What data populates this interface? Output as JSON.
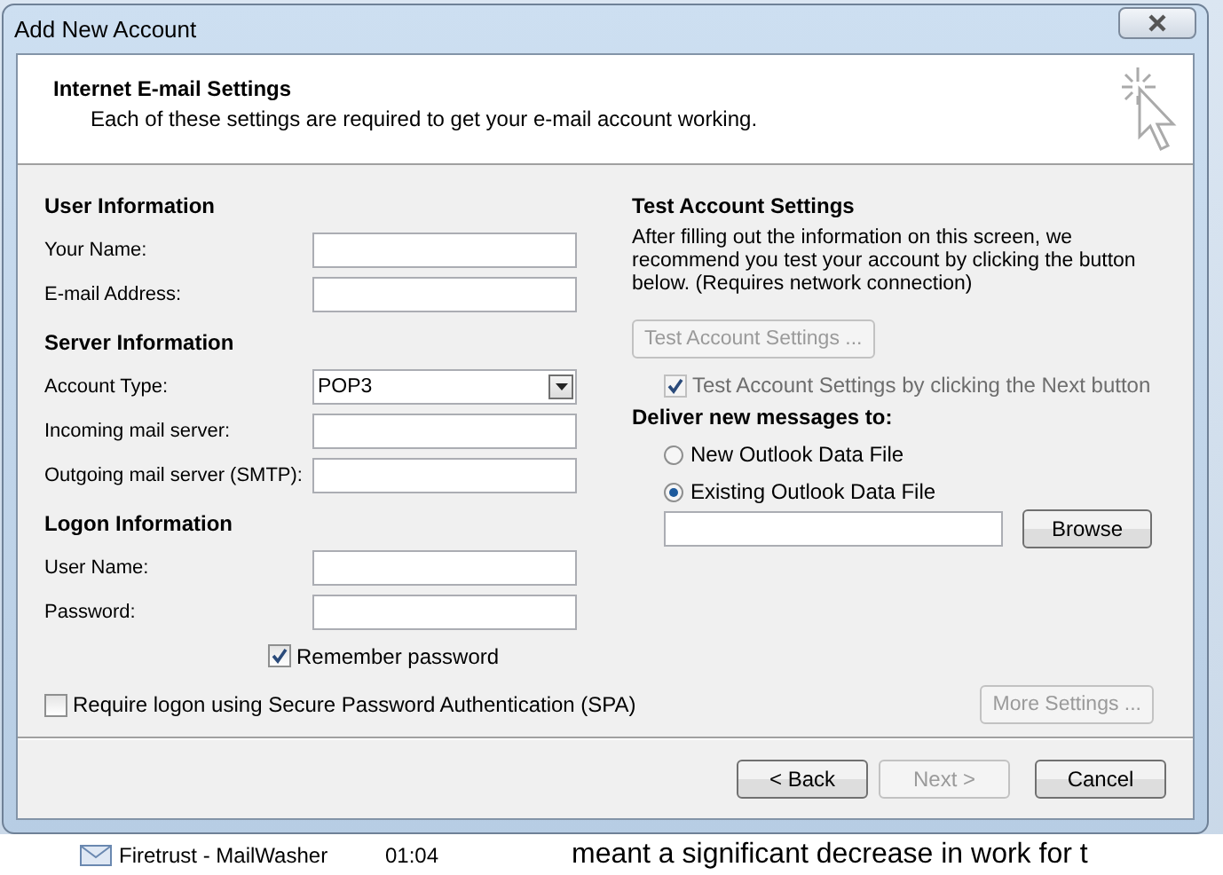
{
  "window": {
    "title": "Add New Account"
  },
  "header": {
    "title": "Internet E-mail Settings",
    "subtitle": "Each of these settings are required to get your e-mail account working."
  },
  "left_sections": [
    {
      "heading": "User Information",
      "fields": [
        {
          "kind": "text",
          "label": "Your Name:"
        },
        {
          "kind": "text",
          "label": "E-mail Address:"
        }
      ]
    },
    {
      "heading": "Server Information",
      "fields": [
        {
          "kind": "dropdown",
          "label": "Account Type:",
          "value": "POP3"
        },
        {
          "kind": "text",
          "label": "Incoming mail server:"
        },
        {
          "kind": "text",
          "label": "Outgoing mail server (SMTP):"
        }
      ]
    },
    {
      "heading": "Logon Information",
      "fields": [
        {
          "kind": "text",
          "label": "User Name:"
        },
        {
          "kind": "text",
          "label": "Password:"
        },
        {
          "kind": "checkbox",
          "label": "Remember password",
          "checked": true
        }
      ]
    }
  ],
  "spa_option": {
    "label": "Require logon using Secure Password Authentication (SPA)",
    "checked": false
  },
  "test_section": {
    "heading": "Test Account Settings",
    "description": "After filling out the information on this screen, we recommend you test your account by clicking the button below. (Requires network connection)",
    "button": {
      "label": "Test Account Settings ...",
      "disabled": true
    },
    "test_on_next": {
      "label": "Test Account Settings by clicking the Next button",
      "checked": true,
      "disabled": true
    }
  },
  "delivery": {
    "heading": "Deliver new messages to:",
    "options": [
      {
        "label": "New Outlook Data File",
        "selected": false
      },
      {
        "label": "Existing Outlook Data File",
        "selected": true
      }
    ],
    "browse_button": {
      "label": "Browse",
      "disabled": false
    }
  },
  "more_settings_button": {
    "label": "More Settings ...",
    "disabled": true
  },
  "footer_buttons": [
    {
      "label": "< Back",
      "disabled": false
    },
    {
      "label": "Next >",
      "disabled": true
    },
    {
      "label": "Cancel",
      "disabled": false
    }
  ],
  "background": {
    "message_sender": "Firetrust - MailWasher",
    "message_time": "01:04",
    "article_text": "meant a significant decrease in work for t"
  }
}
